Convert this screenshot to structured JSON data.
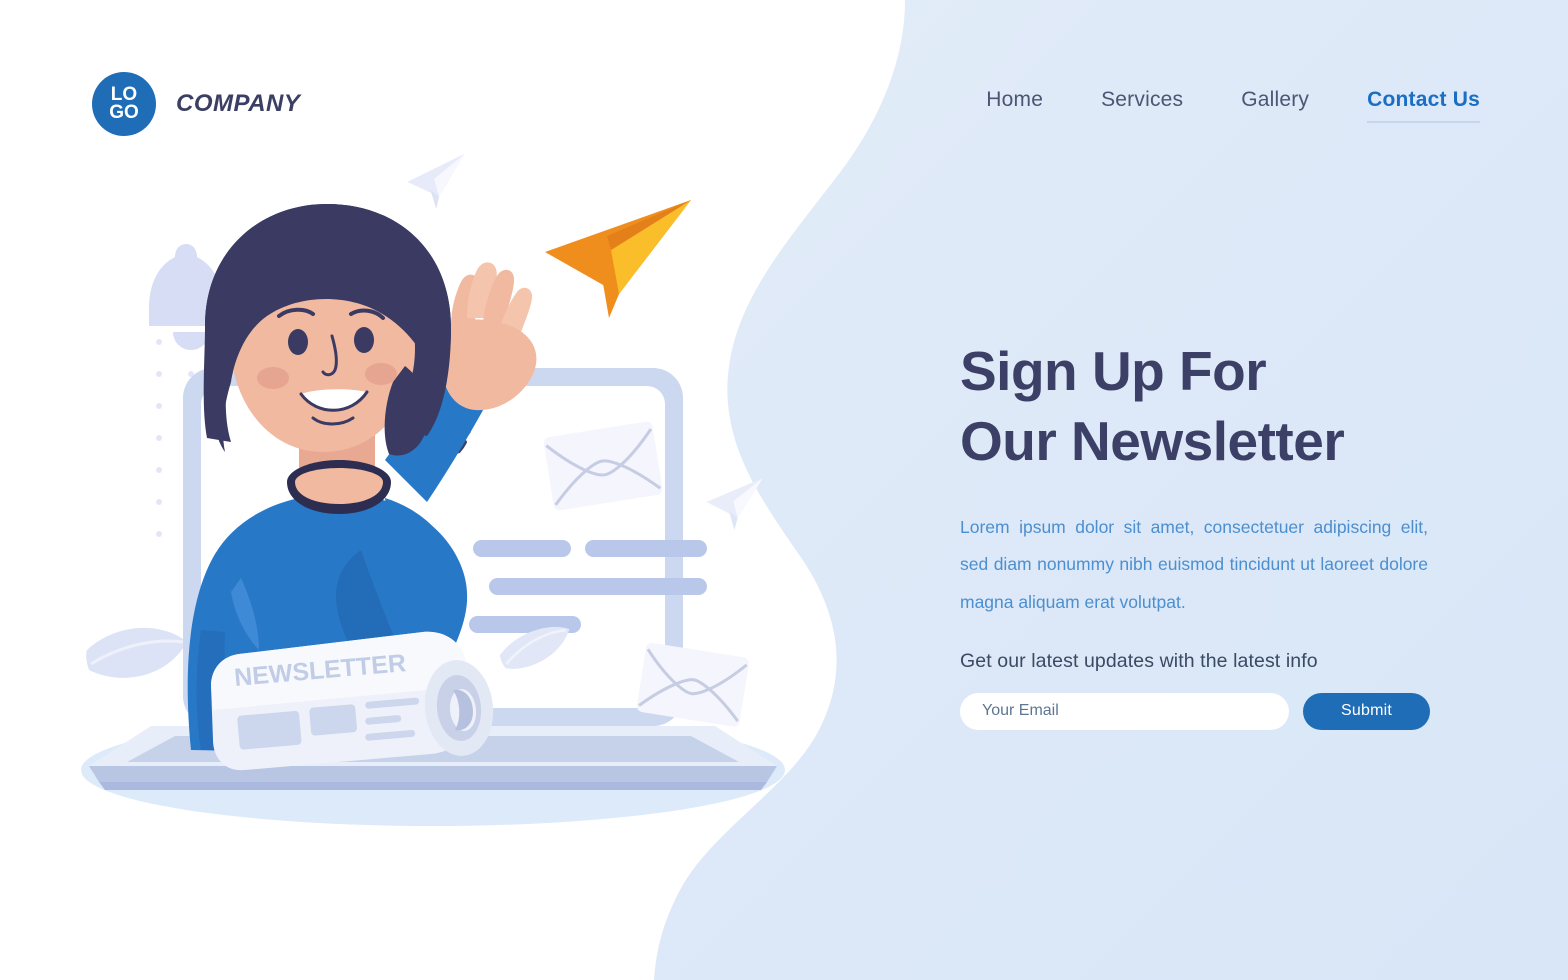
{
  "brand": {
    "logo_line1": "LO",
    "logo_line2": "GO",
    "logo_icon": "logo-circle-icon",
    "company_name": "COMPANY",
    "logo_color": "#1f6cb7"
  },
  "nav": {
    "items": [
      {
        "label": "Home",
        "active": false
      },
      {
        "label": "Services",
        "active": false
      },
      {
        "label": "Gallery",
        "active": false
      },
      {
        "label": "Contact Us",
        "active": true
      }
    ],
    "active_color": "#1a6fc4",
    "inactive_color": "#4a5673"
  },
  "hero": {
    "headline_line1": "Sign Up For",
    "headline_line2": "Our Newsletter",
    "headline_color": "#3c3f66",
    "paragraph": "Lorem ipsum dolor sit amet, consectetuer adipiscing elit, sed diam nonummy nibh euismod tincidunt ut laoreet dolore magna aliquam erat volutpat.",
    "paragraph_color": "#4b8fd0",
    "subheading": "Get our latest updates with the latest info"
  },
  "form": {
    "email_placeholder": "Your Email",
    "email_value": "",
    "submit_label": "Submit",
    "submit_color": "#1f6cb7"
  },
  "illustration": {
    "newspaper_masthead": "NEWSLETTER",
    "colors": {
      "background_light_blue": "#e2ecf8",
      "white_blob": "#ffffff",
      "sweater_blue": "#2878c8",
      "sweater_shadow": "#1f62ab",
      "hair_navy": "#3a3a63",
      "skin": "#f0b9a0",
      "plane_orange_dark": "#ef8b20",
      "plane_orange_light": "#fbbe2b",
      "laptop_frame": "#ccd7f0",
      "placeholder_bar": "#b9c8ea",
      "envelope_white": "#f4f5fd"
    },
    "elements": [
      "bell-icon",
      "dot-grid",
      "orange-paper-plane",
      "white-paper-plane-top",
      "white-paper-plane-right",
      "envelope-upper",
      "envelope-lower",
      "leaf-left",
      "leaf-center",
      "laptop",
      "woman-character",
      "rolled-newspaper"
    ]
  }
}
